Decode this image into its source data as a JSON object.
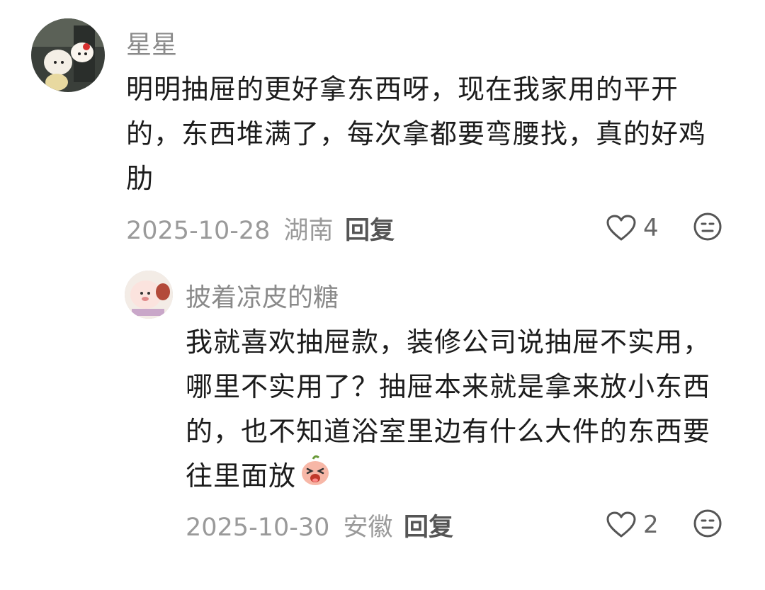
{
  "comments": [
    {
      "username": "星星",
      "text": "明明抽屉的更好拿东西呀，现在我家用的平开的，东西堆满了，每次拿都要弯腰找，真的好鸡肋",
      "date": "2025-10-28",
      "location": "湖南",
      "reply_label": "回复",
      "likes": "4"
    },
    {
      "username": "披着凉皮的糖",
      "text": "我就喜欢抽屉款，装修公司说抽屉不实用，哪里不实用了？抽屉本来就是拿来放小东西的，也不知道浴室里边有什么大件的东西要往里面放",
      "date": "2025-10-30",
      "location": "安徽",
      "reply_label": "回复",
      "likes": "2",
      "inline_emoji": "laughing-peach-emoji"
    }
  ],
  "icons": {
    "like": "heart-outline-icon",
    "emoji": "smiley-face-icon"
  }
}
